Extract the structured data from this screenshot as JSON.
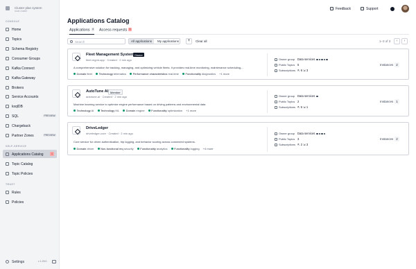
{
  "brand": {
    "name": "Cluster plan system",
    "sub": "local cluster"
  },
  "sidebar": {
    "sections": {
      "console": "CONSOLE",
      "self_service": "SELF-SERVICE",
      "trust": "TRUST"
    },
    "console_items": [
      {
        "label": "Home"
      },
      {
        "label": "Topics"
      },
      {
        "label": "Schema Registry"
      },
      {
        "label": "Consumer Groups"
      },
      {
        "label": "Kafka Connect"
      },
      {
        "label": "Kafka Gateway"
      },
      {
        "label": "Brokers"
      },
      {
        "label": "Service Accounts"
      },
      {
        "label": "ksqlDB"
      },
      {
        "label": "SQL",
        "pill": "PREVIEW"
      },
      {
        "label": "Chargeback"
      },
      {
        "label": "Partner Zones",
        "pill": "PREVIEW"
      }
    ],
    "self_service_items": [
      {
        "label": "Applications Catalog",
        "badge": "1",
        "active": true
      },
      {
        "label": "Topic Catalog"
      },
      {
        "label": "Topic Policies"
      }
    ],
    "trust_items": [
      {
        "label": "Rules"
      },
      {
        "label": "Policies"
      }
    ],
    "settings": {
      "label": "Settings",
      "version": "v 1.29.0"
    }
  },
  "topbar": {
    "feedback": "Feedback",
    "support": "Support"
  },
  "page": {
    "title": "Applications Catalog"
  },
  "tabs": [
    {
      "label": "Applications",
      "count": "4",
      "active": true
    },
    {
      "label": "Access requests",
      "count": "1",
      "red": true
    }
  ],
  "toolbar": {
    "search_placeholder": "Search",
    "seg_all": "All applications",
    "seg_my": "My applications",
    "add": "+",
    "clear": "Clear all",
    "pager": "1–3 of 3",
    "prev": "‹",
    "next": "›"
  },
  "labels": {
    "owner_group": "Owner group",
    "public_topics": "Public Topics",
    "subscriptions": "Subscriptions",
    "data_services": "Data services",
    "instances": "Instances"
  },
  "apps": [
    {
      "name": "Fleet Management System",
      "role": "Owner",
      "meta_id": "fleet-mgmt-app",
      "meta_created": "Created · 2 min ago",
      "description": "A comprehensive solution for tracking, managing, and optimizing vehicle fleets. It provides real-time monitoring, maintenance scheduling,...",
      "tags": [
        {
          "k": "Domain",
          "v": "fleet"
        },
        {
          "k": "Technology",
          "v": "telematics"
        },
        {
          "k": "Performance characteristics",
          "v": "real-time"
        },
        {
          "k": "Functionality",
          "v": "diagnostics"
        }
      ],
      "more": "+1 more",
      "public_topics": "5",
      "subscriptions": "⇱ 6  ⇲ 3",
      "instances": "2"
    },
    {
      "name": "AutoTune AI",
      "role": "Member",
      "meta_id": "autotune-ai",
      "meta_created": "Created · 2 min ago",
      "description": "Machine learning service to optimize engine performance based on driving patterns and environmental data",
      "tags": [
        {
          "k": "Technology",
          "v": "AI"
        },
        {
          "k": "Technology",
          "v": "ML"
        },
        {
          "k": "Domain",
          "v": "engine"
        },
        {
          "k": "Functionality",
          "v": "optimization"
        }
      ],
      "more": "+1 more",
      "public_topics": "2",
      "subscriptions": "⇱ 6  ⇲ 1",
      "instances": "1"
    },
    {
      "name": "DriveLedger",
      "role": "",
      "meta_id": "driveledger-core",
      "meta_created": "Created · 2 min ago",
      "description": "Core service for driver authentication, trip logging, and behavior scoring across connected systems.",
      "tags": [
        {
          "k": "Domain",
          "v": "driver"
        },
        {
          "k": "Non-functional req",
          "v": "security"
        },
        {
          "k": "Functionality",
          "v": "analytics"
        },
        {
          "k": "Functionality",
          "v": "logging"
        }
      ],
      "more": "+4 more",
      "public_topics": "3",
      "subscriptions": "⇱ 2  ⇲ 3",
      "instances": "2"
    }
  ]
}
